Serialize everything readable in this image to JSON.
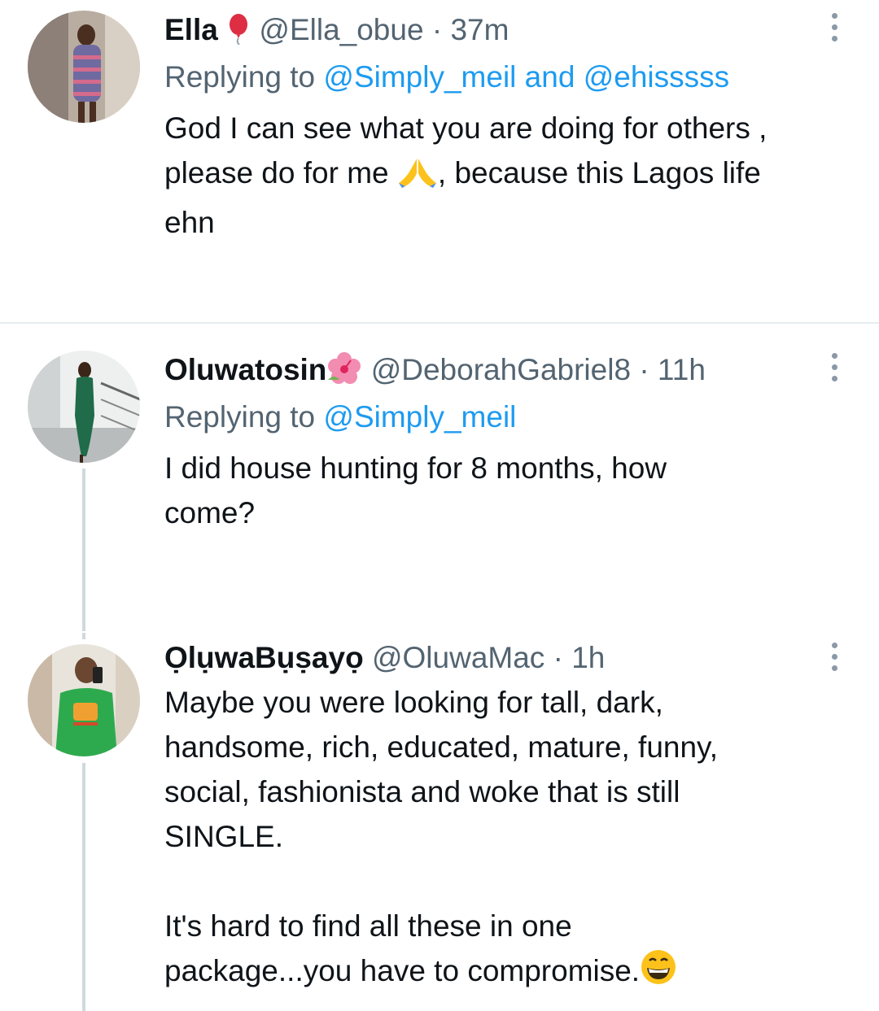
{
  "tweets": [
    {
      "name": "Ella",
      "name_emoji": "balloon-icon",
      "handle": "@Ella_obue",
      "dot": "·",
      "time": "37m",
      "reply_prefix": "Replying to ",
      "reply_mention_1": "@Simply_meil",
      "reply_and": " and ",
      "reply_mention_2": "@ehisssss",
      "text_1": "God I can see what you are doing for others ,\nplease do for me ",
      "text_emoji": "folded-hands-icon",
      "text_2": ", because this Lagos life\nehn"
    },
    {
      "name": "Oluwatosin",
      "name_emoji": "hibiscus-icon",
      "handle": "@DeborahGabriel8",
      "dot": "·",
      "time": "11h",
      "reply_prefix": "Replying to ",
      "reply_mention_1": "@Simply_meil",
      "text_1": "I did house hunting for 8 months, how\ncome?"
    },
    {
      "name": "ỌlụwaBụṣayọ",
      "handle": "@OluwaMac",
      "dot": "·",
      "time": "1h",
      "text_1": "Maybe you were looking for tall, dark,\nhandsome, rich, educated, mature, funny,\nsocial, fashionista and woke that is still\nSINGLE.\n\nIt's hard to find all these in one\npackage...you have to compromise.",
      "text_emoji": "grinning-face-icon"
    }
  ],
  "colors": {
    "text": "#0f1419",
    "secondary": "#536471",
    "link": "#1d9bf0",
    "divider": "#e6ecf0",
    "thread_line": "#cfd9de"
  }
}
